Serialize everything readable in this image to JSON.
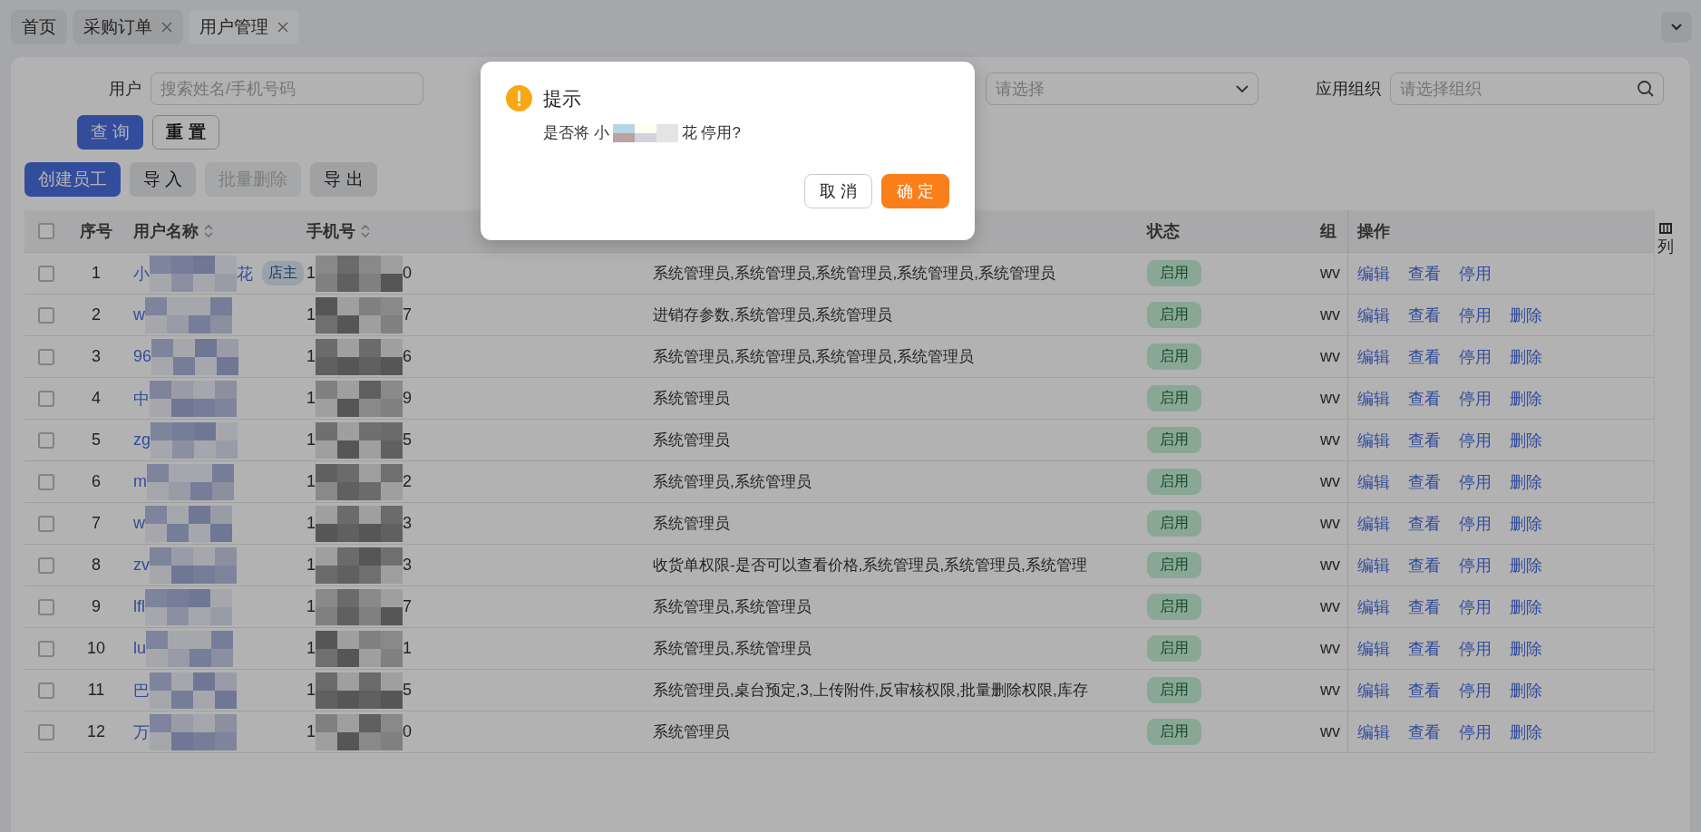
{
  "tabs": [
    {
      "label": "首页",
      "selected": false,
      "closable": false
    },
    {
      "label": "采购订单",
      "selected": false,
      "closable": true
    },
    {
      "label": "用户管理",
      "selected": true,
      "closable": true
    }
  ],
  "filters": {
    "user_label": "用户",
    "user_placeholder": "搜索姓名/手机号码",
    "select_placeholder": "请选择",
    "org_label": "应用组织",
    "org_placeholder": "请选择组织"
  },
  "filter_buttons": [
    {
      "label": "查 询",
      "kind": "primary"
    },
    {
      "label": "重 置",
      "kind": "outline"
    }
  ],
  "toolbar": [
    {
      "label": "创建员工",
      "kind": "primary",
      "disabled": false
    },
    {
      "label": "导 入",
      "kind": "default",
      "disabled": false
    },
    {
      "label": "批量删除",
      "kind": "default",
      "disabled": true
    },
    {
      "label": "导 出",
      "kind": "default",
      "disabled": false
    }
  ],
  "table": {
    "all_checked": false,
    "columns": [
      "序号",
      "用户名称",
      "手机号",
      "状态",
      "组",
      "操作"
    ],
    "column_settings": "列",
    "rows": [
      {
        "checked": false,
        "index": "1",
        "name": "小",
        "name_end": "花",
        "badge": "店主",
        "phone": "1",
        "phone_end": "0",
        "roles": "系统管理员,系统管理员,系统管理员,系统管理员,系统管理员",
        "status": "启用",
        "org": "wv",
        "actions": [
          "编辑",
          "查看",
          "停用"
        ]
      },
      {
        "checked": false,
        "index": "2",
        "name": "w",
        "phone": "1",
        "phone_end": "7",
        "roles": "进销存参数,系统管理员,系统管理员",
        "status": "启用",
        "org": "wv",
        "actions": [
          "编辑",
          "查看",
          "停用",
          "删除"
        ]
      },
      {
        "checked": false,
        "index": "3",
        "name": "96",
        "phone": "1",
        "phone_end": "6",
        "roles": "系统管理员,系统管理员,系统管理员,系统管理员",
        "status": "启用",
        "org": "wv",
        "actions": [
          "编辑",
          "查看",
          "停用",
          "删除"
        ]
      },
      {
        "checked": false,
        "index": "4",
        "name": "中",
        "phone": "1",
        "phone_end": "9",
        "roles": "系统管理员",
        "status": "启用",
        "org": "wv",
        "actions": [
          "编辑",
          "查看",
          "停用",
          "删除"
        ]
      },
      {
        "checked": false,
        "index": "5",
        "name": "zg",
        "phone": "1",
        "phone_end": "5",
        "roles": "系统管理员",
        "status": "启用",
        "org": "wv",
        "actions": [
          "编辑",
          "查看",
          "停用",
          "删除"
        ]
      },
      {
        "checked": false,
        "index": "6",
        "name": "m",
        "phone": "1",
        "phone_end": "2",
        "roles": "系统管理员,系统管理员",
        "status": "启用",
        "org": "wv",
        "actions": [
          "编辑",
          "查看",
          "停用",
          "删除"
        ]
      },
      {
        "checked": false,
        "index": "7",
        "name": "w",
        "phone": "1",
        "phone_end": "3",
        "roles": "系统管理员",
        "status": "启用",
        "org": "wv",
        "actions": [
          "编辑",
          "查看",
          "停用",
          "删除"
        ]
      },
      {
        "checked": false,
        "index": "8",
        "name": "zv",
        "phone": "1",
        "phone_end": "3",
        "roles": "收货单权限-是否可以查看价格,系统管理员,系统管理员,系统管理",
        "status": "启用",
        "org": "wv",
        "actions": [
          "编辑",
          "查看",
          "停用",
          "删除"
        ]
      },
      {
        "checked": false,
        "index": "9",
        "name": "lfl",
        "phone": "1",
        "phone_end": "7",
        "roles": "系统管理员,系统管理员",
        "status": "启用",
        "org": "wv",
        "actions": [
          "编辑",
          "查看",
          "停用",
          "删除"
        ]
      },
      {
        "checked": false,
        "index": "10",
        "name": "lu",
        "phone": "1",
        "phone_end": "1",
        "roles": "系统管理员,系统管理员",
        "status": "启用",
        "org": "wv",
        "actions": [
          "编辑",
          "查看",
          "停用",
          "删除"
        ]
      },
      {
        "checked": false,
        "index": "11",
        "name": "巴",
        "phone": "1",
        "phone_end": "5",
        "roles": "系统管理员,桌台预定,3,上传附件,反审核权限,批量删除权限,库存",
        "status": "启用",
        "org": "wv",
        "actions": [
          "编辑",
          "查看",
          "停用",
          "删除"
        ]
      },
      {
        "checked": false,
        "index": "12",
        "name": "万",
        "phone": "1",
        "phone_end": "0",
        "roles": "系统管理员",
        "status": "启用",
        "org": "wv",
        "actions": [
          "编辑",
          "查看",
          "停用",
          "删除"
        ]
      }
    ]
  },
  "dialog": {
    "title": "提示",
    "message_start": "是否将 小",
    "message_end": "花 停用?",
    "buttons": [
      {
        "label": "取 消",
        "kind": "default"
      },
      {
        "label": "确 定",
        "kind": "primary"
      }
    ]
  }
}
